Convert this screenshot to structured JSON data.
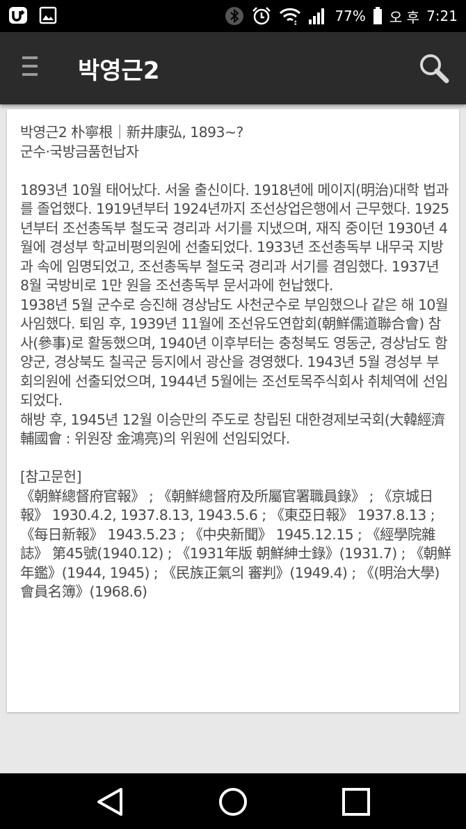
{
  "status_bar": {
    "battery": "77%",
    "ampm": "오 후",
    "time": "7:21",
    "icons": [
      "u-plus-icon",
      "gallery-icon",
      "bluetooth-icon",
      "alarm-icon",
      "wifi-icon",
      "signal-icon",
      "battery-icon"
    ]
  },
  "app_bar": {
    "title": "박영근2",
    "menu_icon": "hamburger-menu-icon",
    "search_icon": "search-icon"
  },
  "article": {
    "heading": "박영근2 朴寧根｜新井康弘, 1893~?",
    "subheading": "군수·국방금품헌납자",
    "body": [
      "1893년 10월 태어났다. 서울 출신이다. 1918년에 메이지(明治)대학 법과를 졸업했다. 1919년부터 1924년까지 조선상업은행에서 근무했다. 1925년부터 조선총독부 철도국 경리과 서기를 지냈으며, 재직 중이던 1930년 4월에 경성부 학교비평의원에 선출되었다. 1933년 조선총독부 내무국 지방과 속에 임명되었고, 조선총독부 철도국 경리과 서기를 겸임했다. 1937년 8월 국방비로 1만 원을 조선총독부 문서과에 헌납했다.",
      "1938년 5월 군수로 승진해 경상남도 사천군수로 부임했으나 같은 해 10월 사임했다. 퇴임 후, 1939년 11월에 조선유도연합회(朝鮮儒道聯合會) 참사(參事)로 활동했으며, 1940년 이후부터는 충청북도 영동군, 경상남도 함양군, 경상북도 칠곡군 등지에서 광산을 경영했다. 1943년 5월 경성부 부회의원에 선출되었으며, 1944년 5월에는 조선토목주식회사 취체역에 선임되었다.",
      "해방 후, 1945년 12월 이승만의 주도로 창립된 대한경제보국회(大韓經濟輔國會 : 위원장 金鴻亮)의 위원에 선임되었다."
    ],
    "references_title": "[참고문헌]",
    "references": "《朝鮮總督府官報》 ; 《朝鮮總督府及所屬官署職員錄》 ; 《京城日報》 1930.4.2, 1937.8.13, 1943.5.6 ; 《東亞日報》 1937.8.13 ; 《每日新報》 1943.5.23 ; 《中央新聞》 1945.12.15 ; 《經學院雜誌》 第45號(1940.12) ; 《1931年版 朝鮮紳士錄》(1931.7) ; 《朝鮮年鑑》(1944, 1945) ; 《民族正氣의 審判》(1949.4) ; 《(明治大學)會員名簿》(1968.6)"
  },
  "nav_bar": {
    "back_icon": "back-triangle-icon",
    "home_icon": "home-circle-icon",
    "recents_icon": "recents-square-icon"
  }
}
